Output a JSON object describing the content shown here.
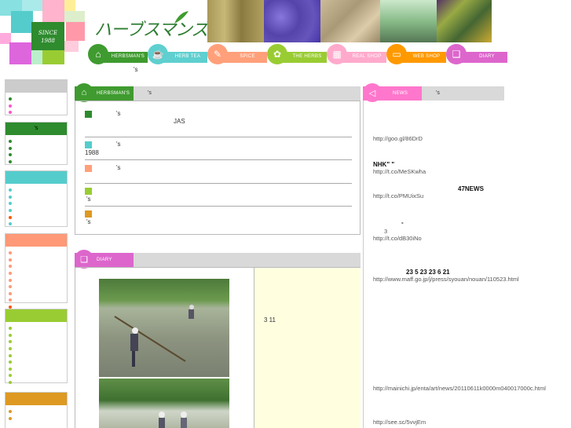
{
  "brand": {
    "since": "SINCE",
    "year": "1988",
    "logo_text": "ハーブスマンズ"
  },
  "nav": [
    {
      "label": "HERBSMAN'S",
      "color": "#3f9b2f",
      "icon": "hat-icon"
    },
    {
      "label": "HERB TEA",
      "color": "#5fcfcf",
      "icon": "teacup-icon"
    },
    {
      "label": "SPICE",
      "color": "#ffa07a",
      "icon": "spoon-icon"
    },
    {
      "label": "THE HERBS",
      "color": "#99cc33",
      "icon": "plant-icon"
    },
    {
      "label": "REAL SHOP",
      "color": "#ffaacc",
      "icon": "shop-icon"
    },
    {
      "label": "WEB SHOP",
      "color": "#ff9900",
      "icon": "laptop-icon"
    },
    {
      "label": "DIARY",
      "color": "#dd66cc",
      "icon": "book-icon"
    }
  ],
  "header_note": "'s",
  "sidebar": [
    {
      "color": "#cccccc",
      "head": "",
      "dot": "#2e8b2e",
      "dots": [
        "#2e8b2e",
        "#ff55cc",
        "#ff55cc"
      ]
    },
    {
      "color": "#2e8b2e",
      "head": "'s",
      "dot": "#2e8b2e",
      "dots": [
        "#2e8b2e",
        "#2e8b2e",
        "#2e8b2e",
        "#2e8b2e"
      ]
    },
    {
      "color": "#55cccc",
      "head": "",
      "dot": "#55cccc",
      "dots": [
        "#55cccc",
        "#55cccc",
        "#55cccc",
        "#55cccc",
        "#ff5500",
        "#55cccc"
      ]
    },
    {
      "color": "#ff9977",
      "head": "",
      "dot": "#ff9977",
      "dots": [
        "#ff9977",
        "#ff9977",
        "#ff9977",
        "#ff9977",
        "#ff9977",
        "#ff9977",
        "#ff9977",
        "#ff9977",
        "#ff5500"
      ]
    },
    {
      "color": "#99cc33",
      "head": "",
      "dot": "#99cc33",
      "dots": [
        "#99cc33",
        "#99cc33",
        "#99cc33",
        "#99cc33",
        "#99cc33",
        "#99cc33",
        "#99cc33",
        "#99cc33",
        "#99cc33"
      ]
    },
    {
      "color": "#dd9922",
      "head": "",
      "dot": "#dd9922",
      "dots": [
        "#dd9922",
        "#dd9922"
      ]
    }
  ],
  "herbsman_panel": {
    "tab": "HERBSMAN'S",
    "tab_note": "'s",
    "rows": [
      {
        "color": "#2e8b2e",
        "title": "'s",
        "extra": "JAS",
        "sub": ""
      },
      {
        "color": "#55cccc",
        "title": "'s",
        "extra": "",
        "sub": "1988"
      },
      {
        "color": "#ffa07a",
        "title": "'s",
        "extra": "",
        "sub": ""
      },
      {
        "color": "#99cc33",
        "title": "",
        "extra": "",
        "sub": "'s"
      },
      {
        "color": "#dd9922",
        "title": "",
        "extra": "",
        "sub": "'s"
      }
    ]
  },
  "diary_panel": {
    "tab": "DIARY",
    "text": "3 11"
  },
  "news_panel": {
    "tab": "NEWS",
    "tab_note": "'s",
    "items": [
      {
        "bold": "",
        "text": "http://goo.gl/86DrD"
      },
      {
        "bold": "NHK\"              \"",
        "text": "http://t.co/MeSKwha"
      },
      {
        "bold": "47NEWS",
        "text": "http://t.co/PMUixSu"
      },
      {
        "bold": "-",
        "pre": "3",
        "text": "http://t.co/dB30iNo"
      },
      {
        "bold": "23 5 23        23 6 21",
        "text": "http://www.maff.go.jp/j/press/syouan/nouan/110523.html"
      },
      {
        "bold": "",
        "text": "http://mainichi.jp/enta/art/news/20110611k0000m040017000c.html"
      },
      {
        "bold": "",
        "text": "http://see.sc/5vvjEm"
      }
    ]
  }
}
